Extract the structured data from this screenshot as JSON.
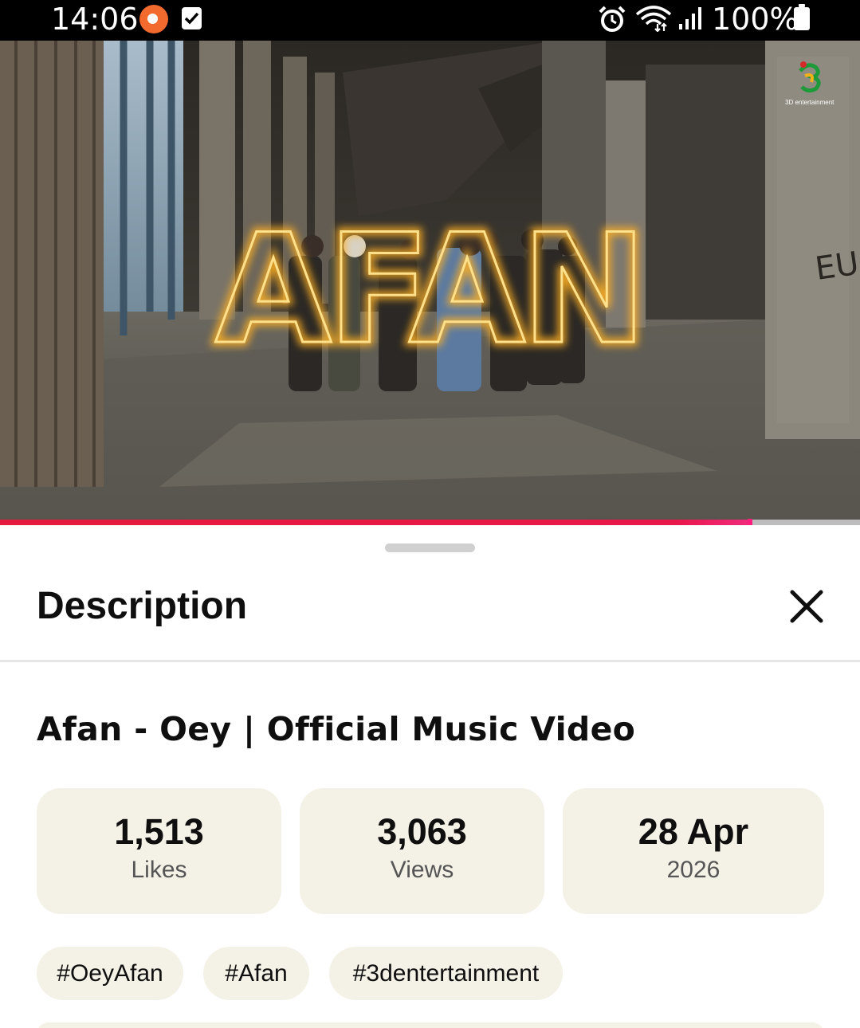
{
  "status_bar": {
    "time": "14:06",
    "battery": "100%",
    "icons": [
      "screen-recorder-icon",
      "checkbox-notification-icon",
      "alarm-icon",
      "wifi-icon",
      "signal-icon",
      "battery-icon"
    ]
  },
  "video": {
    "overlay_text": "AFAN",
    "graffiti": "EU",
    "channel_logo_text": "3D entertainment",
    "progress_fraction": 0.872
  },
  "sheet": {
    "title": "Description",
    "close_icon": "close-icon"
  },
  "details": {
    "video_title": "Afan - Oey | Official Music Video",
    "stats": [
      {
        "value": "1,513",
        "label": "Likes"
      },
      {
        "value": "3,063",
        "label": "Views"
      },
      {
        "value": "28 Apr",
        "label": "2026"
      }
    ],
    "hashtags": [
      "#OeyAfan",
      "#Afan",
      "#3dentertainment"
    ]
  },
  "colors": {
    "progress": "#e61a3c",
    "card_bg": "#f4f1e6",
    "neon": "#ffd24a"
  }
}
